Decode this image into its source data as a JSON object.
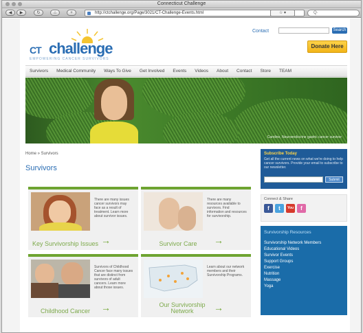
{
  "browser": {
    "title": "Connecticut Challenge",
    "url": "http://ctchallenge.org/Page/3021/CT-Challenge-Events.html",
    "search_placeholder": "Q·"
  },
  "header": {
    "logo_ct": "CT",
    "logo_challenge": "challenge",
    "tagline": "EMPOWERING CANCER SURVIVORS",
    "contact_label": "Contact",
    "search_button": "Search",
    "donate_label": "Donate Here"
  },
  "nav": [
    "Survivors",
    "Medical Community",
    "Ways To Give",
    "Get Involved",
    "Events",
    "Videos",
    "About",
    "Contact",
    "Store",
    "TEAM"
  ],
  "hero": {
    "caption": "Caroline, Neuroendocrine gastric cancer survivor"
  },
  "breadcrumb": "Home » Survivors",
  "page_title": "Survivors",
  "cards": [
    {
      "title": "Key Survivorship Issues",
      "text": "There are many issues cancer survivors may face as a result of treatment. Learn more about survivor issues."
    },
    {
      "title": "Survivor Care",
      "text": "There are many resources available to survivors. Find information and resources for survivorship."
    },
    {
      "title": "Childhood Cancer",
      "text": "Survivors of Childhood Cancer face many issues that are distinct from survivors of adult cancers. Learn more about those issues."
    },
    {
      "title": "Our Survivorship Network",
      "text": "Learn about our network members and their Survivorship Programs."
    }
  ],
  "sidebar": {
    "subscribe_title": "Subscribe Today",
    "subscribe_text": "Get all the current news on what we're doing to help cancer survivors. Provide your email to subscribe to our newsletter.",
    "subscribe_button": "Submit",
    "share_title": "Connect & Share",
    "share_icons": [
      "f",
      "t",
      "You",
      "f"
    ],
    "resources_title": "Survivorship Resources",
    "resources": [
      "Survivorship Network Members",
      "Educational Videos",
      "Survivor Events",
      "Support Groups",
      "Exercise",
      "Nutrition",
      "Massage",
      "Yoga"
    ]
  }
}
